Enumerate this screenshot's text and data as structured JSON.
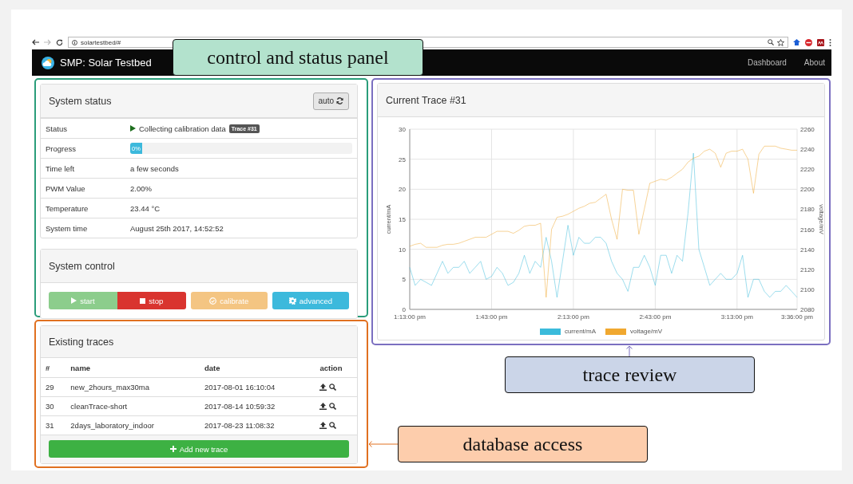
{
  "browser": {
    "url": "solartestbed/#"
  },
  "navbar": {
    "brand": "SMP: Solar Testbed",
    "links": [
      {
        "label": "Dashboard"
      },
      {
        "label": "About"
      }
    ]
  },
  "system_status": {
    "title": "System status",
    "refresh_button": "auto",
    "rows": [
      {
        "kind": "status",
        "label": "Status",
        "value": "Collecting calibration data",
        "badge": "Trace #31"
      },
      {
        "kind": "progress",
        "label": "Progress",
        "level": 0,
        "reading": "0%"
      },
      {
        "kind": "text",
        "label": "Time left",
        "value": "a few seconds"
      },
      {
        "kind": "text",
        "label": "PWM Value",
        "value": "2.00%"
      },
      {
        "kind": "text",
        "label": "Temperature",
        "value": "23.44 °C"
      },
      {
        "kind": "text",
        "label": "System time",
        "value": "August 25th 2017, 14:52:52"
      }
    ]
  },
  "system_control": {
    "title": "System control",
    "buttons": [
      {
        "kind": "start",
        "label": "start",
        "disabled": true
      },
      {
        "kind": "stop",
        "label": "stop",
        "disabled": false
      },
      {
        "kind": "calibrate",
        "label": "calibrate",
        "disabled": true
      },
      {
        "kind": "advanced",
        "label": "advanced",
        "disabled": false
      }
    ]
  },
  "traces": {
    "title": "Existing traces",
    "columns": [
      "#",
      "name",
      "date",
      "action"
    ],
    "rows": [
      {
        "number": "29",
        "name": "new_2hours_max30ma",
        "date": "2017-08-01 16:10:04"
      },
      {
        "number": "30",
        "name": "cleanTrace-short",
        "date": "2017-08-14 10:59:32"
      },
      {
        "number": "31",
        "name": "2days_laboratory_indoor",
        "date": "2017-08-23 11:08:32"
      }
    ],
    "add_button": "Add new trace"
  },
  "trace_chart": {
    "title": "Current Trace #31",
    "chart_data": {
      "type": "line",
      "ylabel": "current/mA",
      "y2label": "voltage/mV",
      "categories": [
        "1:13:00 pm",
        null,
        null,
        null,
        null,
        null,
        null,
        null,
        null,
        null,
        null,
        null,
        null,
        null,
        null,
        "1:43:00 pm",
        null,
        null,
        null,
        null,
        null,
        null,
        null,
        null,
        null,
        null,
        null,
        null,
        null,
        null,
        "2:13:00 pm",
        null,
        null,
        null,
        null,
        null,
        null,
        null,
        null,
        null,
        null,
        null,
        null,
        null,
        null,
        "2:43:00 pm",
        null,
        null,
        null,
        null,
        null,
        null,
        null,
        null,
        null,
        null,
        null,
        null,
        null,
        null,
        "3:13:00 pm",
        null,
        null,
        null,
        null,
        null,
        null,
        null,
        null,
        null,
        null,
        "3:36:00 pm"
      ],
      "grid": true,
      "legend": "bottom",
      "ylim": [
        0,
        30
      ],
      "y2lim": [
        2080,
        2260
      ],
      "yticks": [
        0,
        5,
        10,
        15,
        20,
        25,
        30
      ],
      "y2ticks": [
        2080,
        2100,
        2120,
        2140,
        2160,
        2180,
        2200,
        2220,
        2240,
        2260
      ],
      "series": [
        {
          "name": "current/mA",
          "color": "#3bbbdb",
          "values": [
            7,
            4,
            5,
            4.5,
            4,
            6,
            8,
            6,
            7,
            7,
            8,
            6,
            7,
            8,
            5,
            5.5,
            7,
            6,
            4,
            4.5,
            6,
            9,
            6,
            8,
            7,
            12,
            8,
            2,
            8,
            14,
            9,
            12,
            11,
            11,
            12,
            12,
            11,
            8,
            6,
            5,
            3,
            7,
            7,
            9,
            7,
            4,
            9,
            9,
            6,
            9,
            8,
            16,
            26,
            10,
            7,
            4,
            5,
            6,
            5,
            5,
            6,
            9,
            2,
            5,
            5,
            3,
            2,
            3,
            3,
            4,
            3,
            2
          ]
        },
        {
          "name": "voltage/mV",
          "color": "#f0a830",
          "axis": "y2",
          "values": [
            2143,
            2145,
            2146,
            2142,
            2142,
            2142,
            2144,
            2145,
            2145,
            2146,
            2148,
            2150,
            2152,
            2152,
            2152,
            2155,
            2158,
            2158,
            2158,
            2156,
            2159,
            2163,
            2164,
            2164,
            2166,
            2092,
            2160,
            2172,
            2173,
            2175,
            2178,
            2181,
            2183,
            2186,
            2187,
            2191,
            2195,
            2170,
            2150,
            2200,
            2199,
            2199,
            2155,
            2180,
            2206,
            2208,
            2210,
            2209,
            2212,
            2216,
            2220,
            2227,
            2231,
            2233,
            2238,
            2240,
            2236,
            2222,
            2236,
            2238,
            2238,
            2240,
            2230,
            2196,
            2235,
            2243,
            2243,
            2243,
            2241,
            2240,
            2239,
            2239
          ]
        }
      ]
    }
  },
  "annotations": [
    {
      "text": "control and status panel",
      "color": "#b3e2cd"
    },
    {
      "text": "trace review",
      "color": "#cbd5e8"
    },
    {
      "text": "database access",
      "color": "#fdcdac"
    }
  ]
}
